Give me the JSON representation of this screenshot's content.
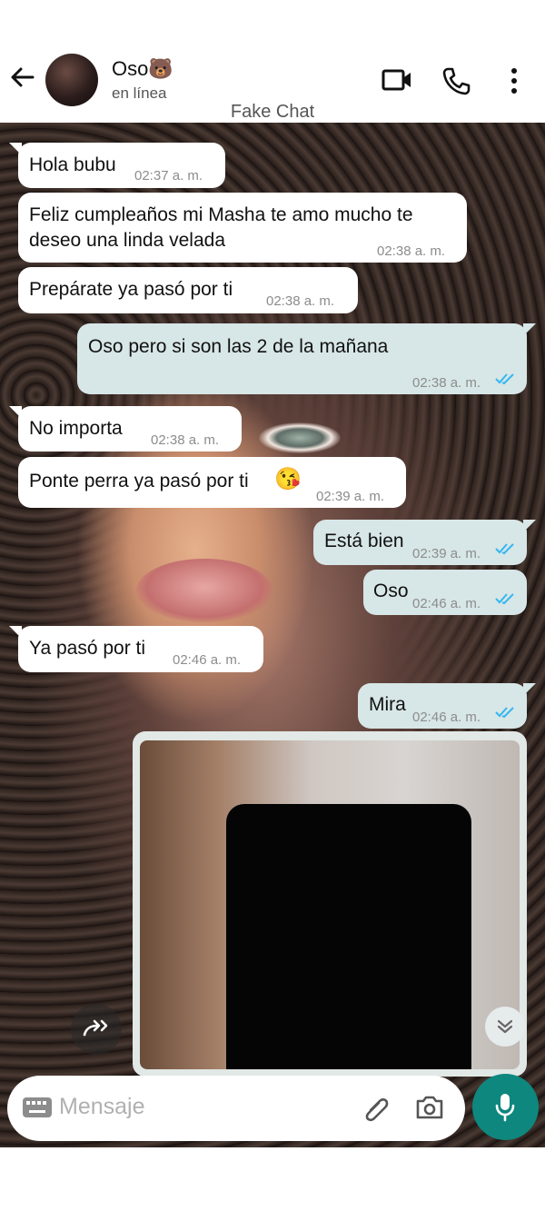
{
  "header": {
    "contact_name": "Oso🐻",
    "status": "en línea",
    "watermark": "Fake Chat",
    "icons": [
      "back-arrow-icon",
      "avatar",
      "video-call-icon",
      "phone-icon",
      "more-options-icon"
    ]
  },
  "messages": [
    {
      "dir": "in",
      "text": "Hola bubu",
      "time": "02:37 a. m."
    },
    {
      "dir": "in",
      "text_line1": "Feliz cumpleaños mi Masha te amo mucho te",
      "text_line2": "deseo una linda velada",
      "time": "02:38 a. m."
    },
    {
      "dir": "in",
      "text": "Prepárate ya pasó por ti",
      "time": "02:38 a. m."
    },
    {
      "dir": "out",
      "text": "Oso pero si son las 2 de la mañana",
      "time": "02:38 a. m."
    },
    {
      "dir": "in",
      "text": "No importa",
      "time": "02:38 a. m."
    },
    {
      "dir": "in",
      "text": "Ponte perra ya pasó por ti",
      "emoji": "😘",
      "time": "02:39 a. m."
    },
    {
      "dir": "out",
      "text": "Está bien",
      "time": "02:39 a. m."
    },
    {
      "dir": "out",
      "text": "Oso",
      "time": "02:46 a. m."
    },
    {
      "dir": "in",
      "text": "Ya pasó por ti",
      "time": "02:46 a. m."
    },
    {
      "dir": "out",
      "text": "Mira",
      "time": "02:46 a. m."
    }
  ],
  "composer": {
    "placeholder": "Mensaje"
  },
  "colors": {
    "incoming_bubble": "#ffffff",
    "outgoing_bubble": "#d7e6e6",
    "read_ticks": "#34b7f1",
    "mic_button": "#0e877e"
  }
}
